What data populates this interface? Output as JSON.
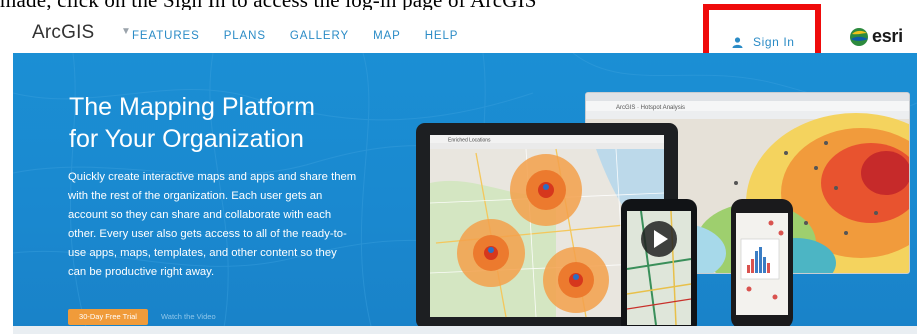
{
  "top_cut_text": "made, click on the Sign In to access the log-in page of ArcGIS",
  "nav": {
    "logo": "ArcGIS",
    "menu": [
      "FEATURES",
      "PLANS",
      "GALLERY",
      "MAP",
      "HELP"
    ],
    "sign_in": "Sign In",
    "brand": "esri"
  },
  "hero": {
    "title_line1": "The Mapping Platform",
    "title_line2": "for Your Organization",
    "body": "Quickly create interactive maps and apps and share them with the rest of the organization. Each user gets an account so they can share and collaborate with each other. Every user also gets access to all of the ready-to-use apps, maps, templates, and other content so they can be productive right away.",
    "trial_button": "30-Day Free Trial",
    "watch_link": "Watch the Video"
  },
  "devices": {
    "laptop_title": "Hotspot Analysis",
    "tablet_title": "Enriched Locations"
  },
  "colors": {
    "accent": "#2a8bc6",
    "hero_bg": "#1a88cf",
    "highlight_box": "#ef0b0b",
    "trial": "#f09b3a"
  }
}
